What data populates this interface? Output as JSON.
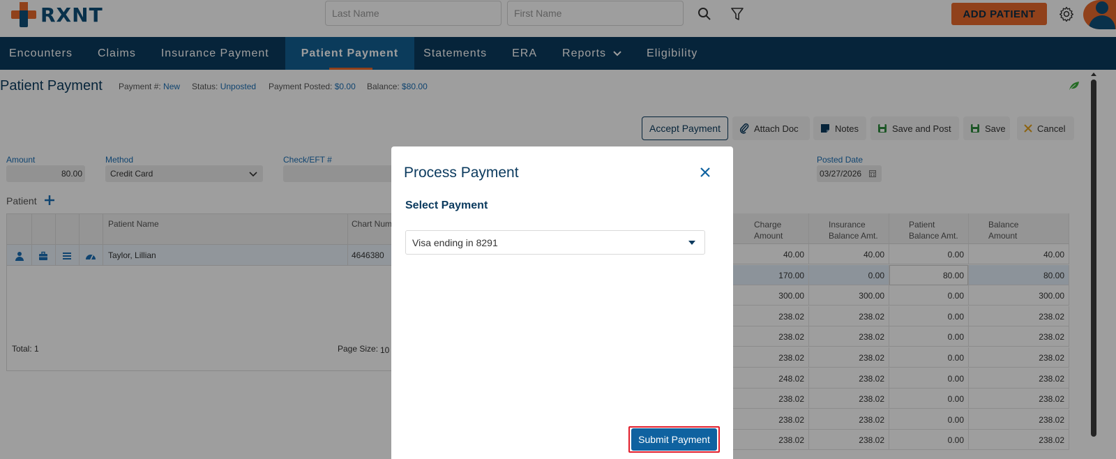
{
  "header": {
    "logo_text": "RXNT",
    "last_name_placeholder": "Last Name",
    "first_name_placeholder": "First Name",
    "add_patient_label": "ADD PATIENT"
  },
  "nav": {
    "items": [
      "Encounters",
      "Claims",
      "Insurance Payment",
      "Patient Payment",
      "Statements",
      "ERA",
      "Reports",
      "Eligibility"
    ],
    "active": "Patient Payment"
  },
  "page": {
    "title": "Patient Payment",
    "payment_no_label": "Payment #:",
    "payment_no_value": "New",
    "status_label": "Status:",
    "status_value": "Unposted",
    "posted_label": "Payment Posted:",
    "posted_value": "$0.00",
    "balance_label": "Balance:",
    "balance_value": "$80.00"
  },
  "toolbar": {
    "accept_payment": "Accept Payment",
    "attach_doc": "Attach Doc",
    "notes": "Notes",
    "save_and_post": "Save and Post",
    "save": "Save",
    "cancel": "Cancel"
  },
  "form": {
    "amount_label": "Amount",
    "amount_value": "80.00",
    "method_label": "Method",
    "method_value": "Credit Card",
    "check_label": "Check/EFT #",
    "posted_date_label": "Posted Date",
    "posted_date_value": "03/27/2026"
  },
  "patient_grid": {
    "section_label": "Patient",
    "col_patient_name": "Patient Name",
    "col_chart_num": "Chart Num",
    "row_name": "Taylor, Lillian",
    "row_chart": "4646380",
    "total": "Total: 1",
    "page_size_label": "Page Size:",
    "page_size_value": "10"
  },
  "charges": {
    "headers": [
      [
        "Charge",
        "Amount"
      ],
      [
        "Insurance",
        "Balance Amt."
      ],
      [
        "Patient",
        "Balance Amt."
      ],
      [
        "Balance",
        "Amount"
      ]
    ],
    "rows": [
      [
        "40.00",
        "40.00",
        "0.00",
        "40.00"
      ],
      [
        "170.00",
        "0.00",
        "80.00",
        "80.00"
      ],
      [
        "300.00",
        "300.00",
        "0.00",
        "300.00"
      ],
      [
        "238.02",
        "238.02",
        "0.00",
        "238.02"
      ],
      [
        "238.02",
        "238.02",
        "0.00",
        "238.02"
      ],
      [
        "238.02",
        "238.02",
        "0.00",
        "238.02"
      ],
      [
        "248.02",
        "238.02",
        "0.00",
        "238.02"
      ],
      [
        "238.02",
        "238.02",
        "0.00",
        "238.02"
      ],
      [
        "238.02",
        "238.02",
        "0.00",
        "238.02"
      ],
      [
        "238.02",
        "238.02",
        "0.00",
        "238.02"
      ]
    ]
  },
  "modal": {
    "title": "Process Payment",
    "subtitle": "Select Payment",
    "selected_payment": "Visa ending in 8291",
    "submit_label": "Submit Payment"
  }
}
